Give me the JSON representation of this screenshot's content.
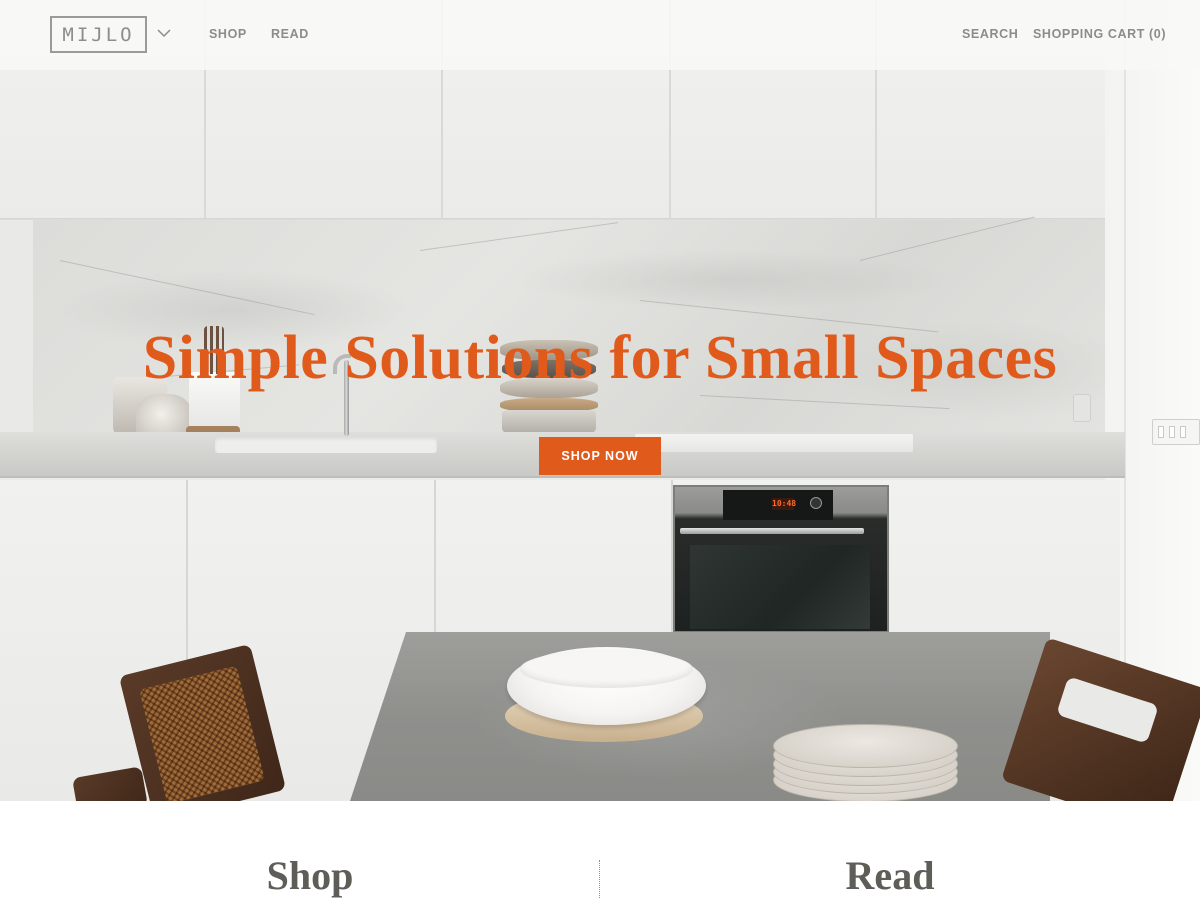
{
  "header": {
    "logo_text": "MIJLO",
    "nav": {
      "shop": "SHOP",
      "read": "READ",
      "search": "SEARCH",
      "cart": "SHOPPING CART (0)"
    }
  },
  "hero": {
    "title": "Simple Solutions for Small Spaces",
    "cta_label": "SHOP NOW",
    "oven_display": "10:48"
  },
  "sections": {
    "shop_title": "Shop",
    "read_title": "Read"
  },
  "colors": {
    "accent": "#e05a1c",
    "nav_text": "#8c8c89",
    "heading_text": "#5f5d58"
  },
  "icons": {
    "logo_menu": "chevron-down-icon"
  }
}
